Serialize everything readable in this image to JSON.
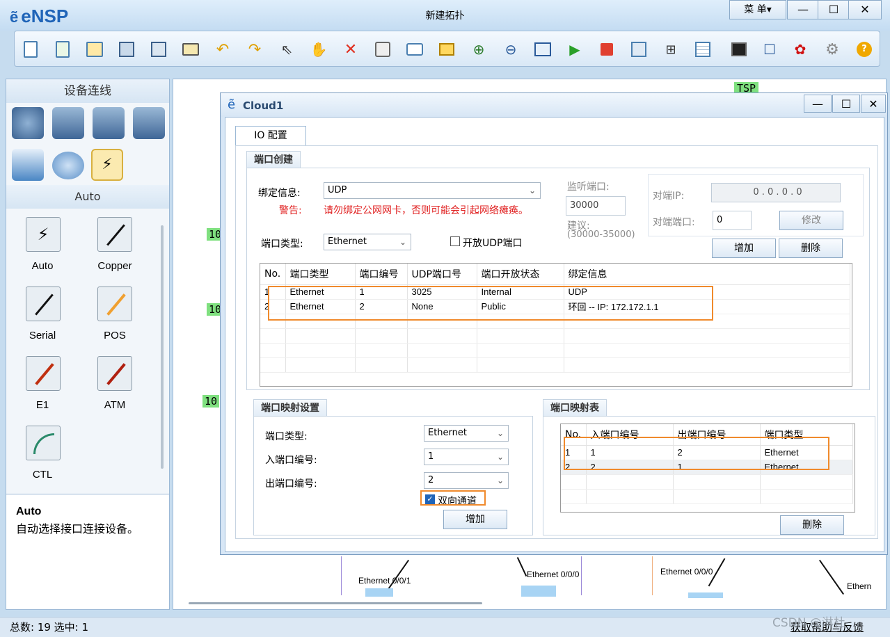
{
  "app": {
    "logo": "eNSP",
    "window_title": "新建拓扑",
    "menu_label": "菜 单▾",
    "min": "—",
    "max": "☐",
    "close": "✕"
  },
  "toolbar": {
    "icons": [
      "new-topology-icon",
      "new-example-icon",
      "open-icon",
      "save-icon",
      "save-as-icon",
      "print-icon",
      "undo-icon",
      "redo-icon",
      "select-icon",
      "pan-icon",
      "delete-icon",
      "delete-link-icon",
      "text-icon",
      "rectangle-icon",
      "zoom-in-icon",
      "zoom-out-icon",
      "fit-icon",
      "start-icon",
      "stop-icon",
      "capture-icon",
      "topology-icon",
      "grid-icon",
      "console-icon",
      "chat-icon",
      "huawei-icon",
      "settings-icon",
      "help-icon"
    ]
  },
  "left": {
    "devices_title": "设备连线",
    "auto_title": "Auto",
    "links": [
      {
        "label": "Auto"
      },
      {
        "label": "Copper"
      },
      {
        "label": "Serial"
      },
      {
        "label": "POS"
      },
      {
        "label": "E1"
      },
      {
        "label": "ATM"
      },
      {
        "label": "CTL"
      }
    ],
    "desc_title": "Auto",
    "desc_text": "自动选择接口连接设备。"
  },
  "canvas": {
    "tsp": "TSP",
    "tags": [
      "10",
      "10",
      "10"
    ],
    "port_labels": [
      "Ethernet 0/0/1",
      "Ethernet 0/0/0",
      "Ethernet 0/0/0",
      "Ethern"
    ]
  },
  "dialog": {
    "title": "Cloud1",
    "tab": "IO 配置",
    "create": {
      "title": "端口创建",
      "bind_label": "绑定信息:",
      "bind_value": "UDP",
      "warn_label": "警告:",
      "warn_text": "请勿绑定公网网卡，否则可能会引起网络瘫痪。",
      "listen_label": "监听端口:",
      "listen_value": "30000",
      "suggest_label": "建议:",
      "suggest_range": "(30000-35000)",
      "peer_ip_label": "对端IP:",
      "peer_ip_value": "0 . 0 . 0 . 0",
      "peer_port_label": "对端端口:",
      "peer_port_value": "0",
      "modify_btn": "修改",
      "port_type_label": "端口类型:",
      "port_type_value": "Ethernet",
      "udp_open_label": "开放UDP端口",
      "add_btn": "增加",
      "del_btn": "删除",
      "columns": [
        "No.",
        "端口类型",
        "端口编号",
        "UDP端口号",
        "端口开放状态",
        "绑定信息"
      ],
      "rows": [
        [
          "1",
          "Ethernet",
          "1",
          "3025",
          "Internal",
          "UDP"
        ],
        [
          "2",
          "Ethernet",
          "2",
          "None",
          "Public",
          "环回 -- IP: 172.172.1.1"
        ]
      ]
    },
    "mapping": {
      "title": "端口映射设置",
      "type_label": "端口类型:",
      "type_value": "Ethernet",
      "in_label": "入端口编号:",
      "in_value": "1",
      "out_label": "出端口编号:",
      "out_value": "2",
      "bidir_label": "双向通道",
      "bidir_checked": true,
      "add_btn": "增加"
    },
    "map_table": {
      "title": "端口映射表",
      "columns": [
        "No.",
        "入端口编号",
        "出端口编号",
        "端口类型"
      ],
      "rows": [
        [
          "1",
          "1",
          "2",
          "Ethernet"
        ],
        [
          "2",
          "2",
          "1",
          "Ethernet"
        ]
      ],
      "del_btn": "删除"
    }
  },
  "status": {
    "total": "总数: 19 选中: 1",
    "right": "获取帮助与反馈",
    "watermark": "CSDN @淋杜"
  }
}
